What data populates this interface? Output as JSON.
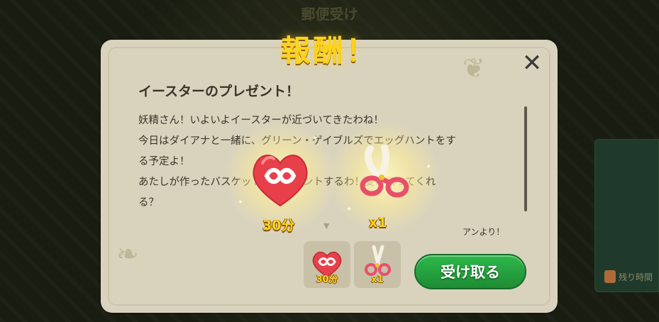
{
  "screen": {
    "title": "郵便受け",
    "side_label": "残り時間"
  },
  "reward": {
    "title": "報酬！",
    "items": [
      {
        "icon": "infinite-heart-icon",
        "label": "30分"
      },
      {
        "icon": "pink-scissors-icon",
        "label": "x1"
      }
    ]
  },
  "mail": {
    "subject": "イースターのプレゼント！",
    "body": [
      "妖精さん！いよいよイースターが近づいてきたわね！",
      "今日はダイアナと一緒に、グリーン・ゲイブルズでエッグハントをす",
      "る予定よ！",
      "あたしが作ったバスケットをプレゼントするわ！受け取ってくれ",
      "る？"
    ],
    "signature": "アンより！",
    "attachments": [
      {
        "icon": "infinite-heart-icon",
        "label": "30分"
      },
      {
        "icon": "pink-scissors-icon",
        "label": "x1"
      }
    ],
    "receive_label": "受け取る",
    "close_icon": "close-icon"
  },
  "colors": {
    "gold": "#ffd21c",
    "button_green": "#2db84a",
    "panel": "#d9d3be",
    "heart_red": "#e8404a"
  }
}
